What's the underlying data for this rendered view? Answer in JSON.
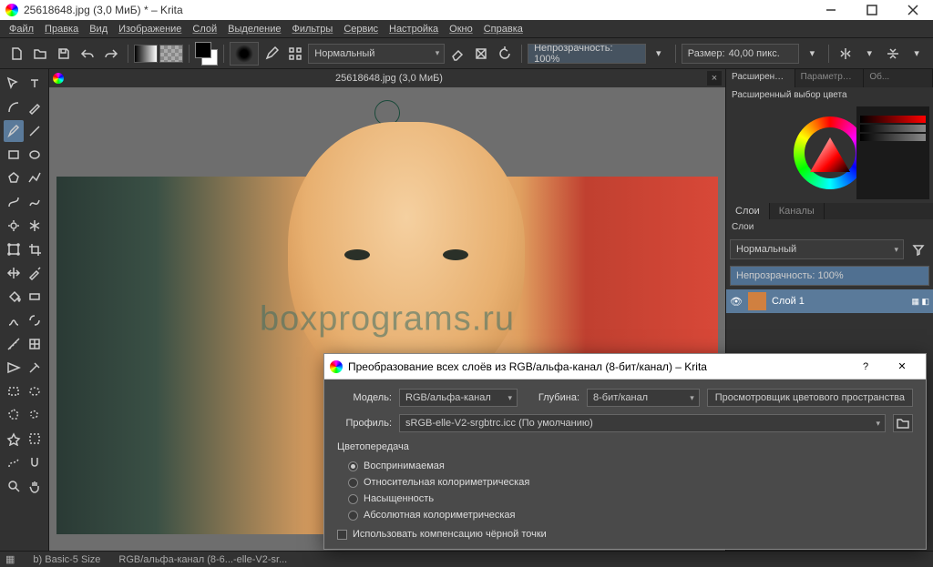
{
  "window": {
    "title": "25618648.jpg (3,0 МиБ) * – Krita"
  },
  "menubar": [
    "Файл",
    "Правка",
    "Вид",
    "Изображение",
    "Слой",
    "Выделение",
    "Фильтры",
    "Сервис",
    "Настройка",
    "Окно",
    "Справка"
  ],
  "toolbar": {
    "blend_mode": "Нормальный",
    "opacity_label": "Непрозрачность:",
    "opacity_value": "100%",
    "size_label": "Размер:",
    "size_value": "40,00 пикс."
  },
  "document": {
    "tab_label": "25618648.jpg (3,0 МиБ)",
    "watermark": "boxprograms.ru"
  },
  "rightdock": {
    "tabs": [
      "Расширенный в...",
      "Параметры ин...",
      "Об..."
    ],
    "color_title": "Расширенный выбор цвета",
    "layers_tabs": [
      "Слои",
      "Каналы"
    ],
    "layers_title": "Слои",
    "layer_blend": "Нормальный",
    "layer_opacity_label": "Непрозрачность:",
    "layer_opacity_value": "100%",
    "layer_name": "Слой 1"
  },
  "statusbar": {
    "brush": "b) Basic-5 Size",
    "colorspace": "RGB/альфа-канал (8-6...-elle-V2-sr..."
  },
  "dialog": {
    "title": "Преобразование всех слоёв из RGB/альфа-канал (8-бит/канал) – Krita",
    "model_label": "Модель:",
    "model_value": "RGB/альфа-канал",
    "depth_label": "Глубина:",
    "depth_value": "8-бит/канал",
    "browser_btn": "Просмотровщик цветового пространства",
    "profile_label": "Профиль:",
    "profile_value": "sRGB-elle-V2-srgbtrc.icc (По умолчанию)",
    "rendering_title": "Цветопередача",
    "rendering_options": [
      "Воспринимаемая",
      "Относительная колориметрическая",
      "Насыщенность",
      "Абсолютная колориметрическая"
    ],
    "rendering_selected": 0,
    "blackpoint": "Использовать компенсацию чёрной точки"
  }
}
